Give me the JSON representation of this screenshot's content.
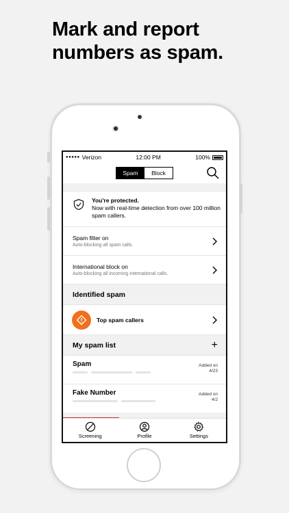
{
  "headline": {
    "line1": "Mark and report",
    "line2": "numbers as spam."
  },
  "status_bar": {
    "carrier": "Verizon",
    "time": "12:00 PM",
    "battery": "100%"
  },
  "nav": {
    "segments": [
      "Spam",
      "Block"
    ],
    "active_segment": "Spam",
    "search_icon": "search-icon"
  },
  "protection": {
    "title": "You're protected.",
    "body": "Now with real-time detection from over 100 million spam callers."
  },
  "settings_rows": [
    {
      "title": "Spam filter on",
      "subtitle": "Auto-blocking all spam calls."
    },
    {
      "title": "International block on",
      "subtitle": "Auto-blocking all incoming international calls."
    }
  ],
  "identified": {
    "heading": "Identified spam",
    "top_callers_label": "Top spam callers"
  },
  "spam_list": {
    "heading": "My spam list",
    "add_symbol": "+",
    "entries": [
      {
        "name": "Spam",
        "added_label": "Added on",
        "added_date": "4/23"
      },
      {
        "name": "Fake Number",
        "added_label": "Added on",
        "added_date": "4/2"
      }
    ]
  },
  "tabs": [
    {
      "label": "Screening",
      "icon": "screening-icon"
    },
    {
      "label": "Profile",
      "icon": "profile-icon"
    },
    {
      "label": "Settings",
      "icon": "gear-icon"
    }
  ],
  "colors": {
    "accent_orange": "#f0701e",
    "progress_red": "#cd3b2f",
    "background": "#f2f2f2"
  }
}
